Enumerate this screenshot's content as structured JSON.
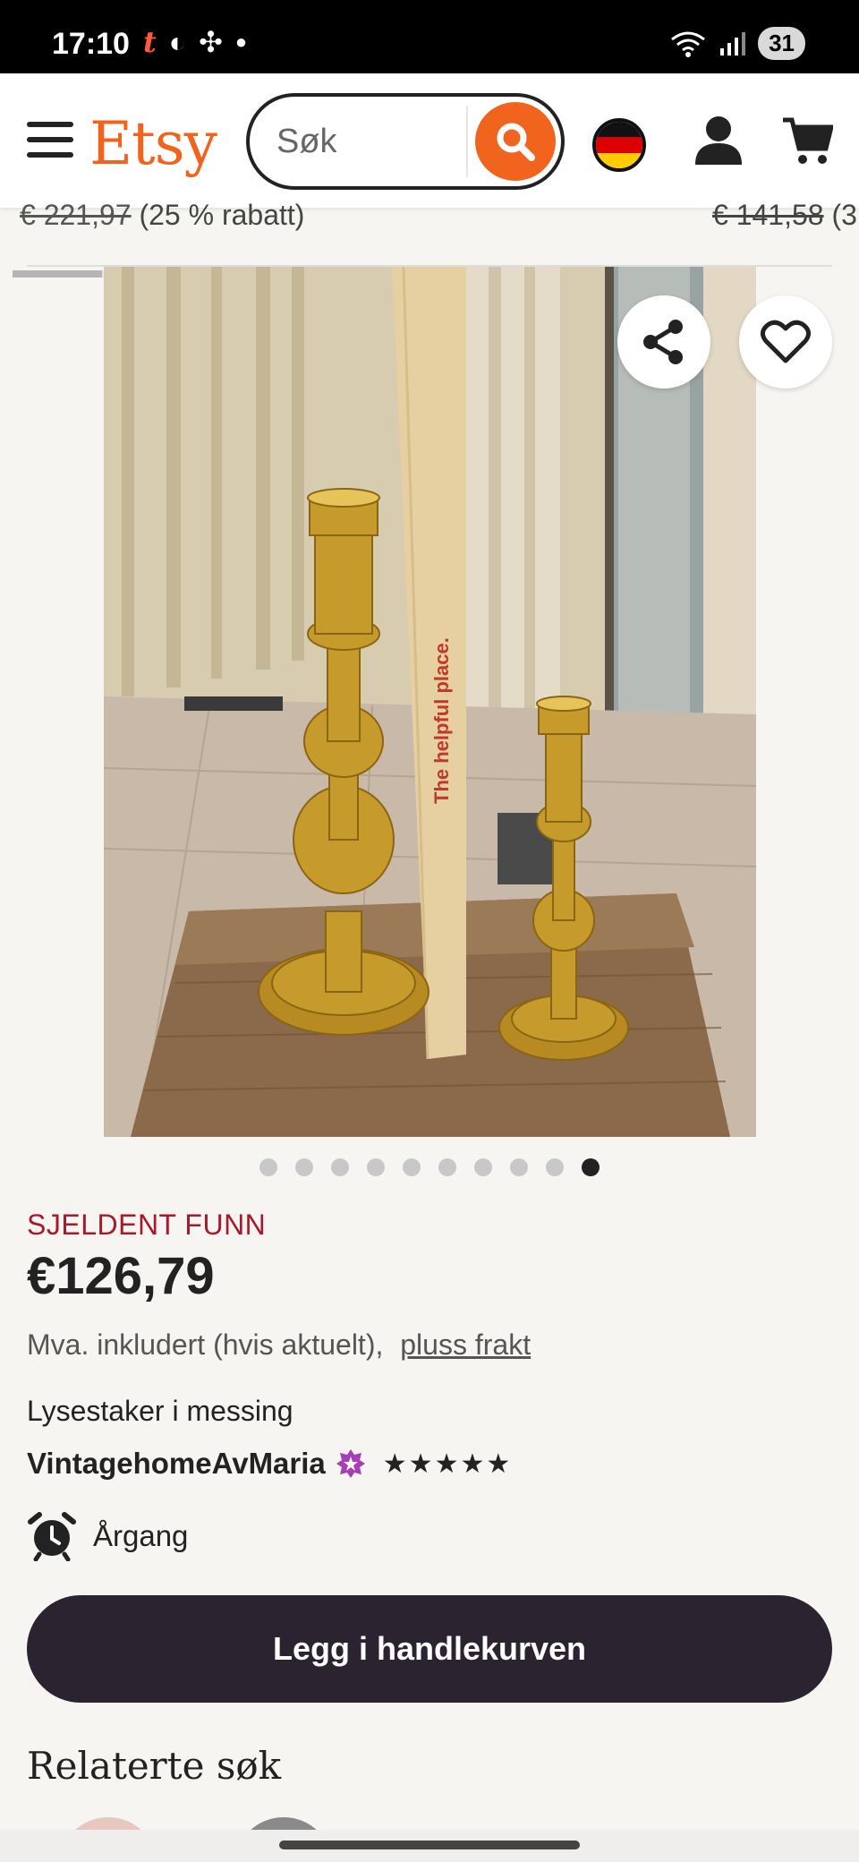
{
  "status_bar": {
    "time": "17:10",
    "battery": "31"
  },
  "header": {
    "logo": "Etsy",
    "search_placeholder": "Søk"
  },
  "price_strip": {
    "left_old_price": "€ 221,97",
    "left_discount": "(25 % rabatt)",
    "right_old_price": "€ 141,58",
    "right_suffix": "(3"
  },
  "gallery": {
    "image_count": 10,
    "active_index": 9
  },
  "product": {
    "badge": "SJELDENT FUNN",
    "price": "€126,79",
    "vat_text": "Mva. inkludert (hvis aktuelt),",
    "shipping_link": "pluss frakt",
    "title": "Lysestaker i messing",
    "shop_name": "VintagehomeAvMaria",
    "rating_stars": "★★★★★",
    "rating_value": 5,
    "vintage_label": "Årgang",
    "add_to_cart": "Legg i handlekurven"
  },
  "related": {
    "heading": "Relaterte søk"
  },
  "colors": {
    "brand": "#f1641e",
    "rare_badge": "#a61a2e",
    "button": "#2b2330"
  }
}
